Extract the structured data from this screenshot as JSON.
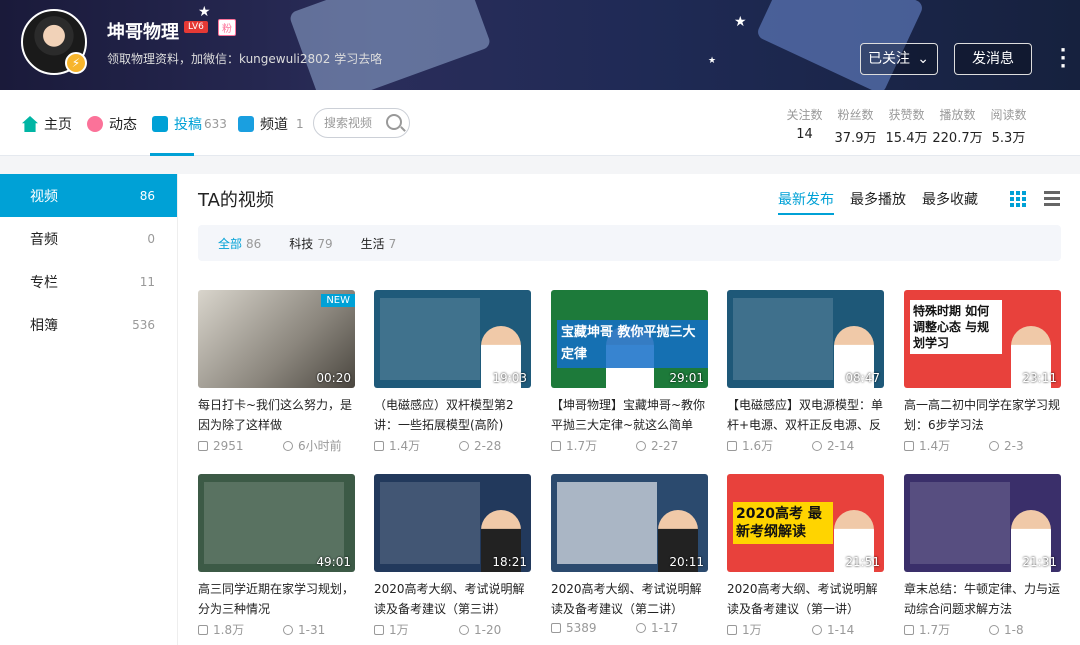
{
  "header": {
    "username": "坤哥物理",
    "level": "LV6",
    "badge": "粉",
    "signature": "领取物理资料，加微信：kungewuli2802 学习去咯",
    "follow_label": "已关注",
    "message_label": "发消息"
  },
  "nav": {
    "home": "主页",
    "dynamic": "动态",
    "uploads": "投稿",
    "uploads_count": "633",
    "channel": "频道",
    "channel_count": "1",
    "search_placeholder": "搜索视频"
  },
  "stats": [
    {
      "label": "关注数",
      "value": "14"
    },
    {
      "label": "粉丝数",
      "value": "37.9万"
    },
    {
      "label": "获赞数",
      "value": "15.4万"
    },
    {
      "label": "播放数",
      "value": "220.7万"
    },
    {
      "label": "阅读数",
      "value": "5.3万"
    }
  ],
  "sidebar": [
    {
      "label": "视频",
      "count": "86"
    },
    {
      "label": "音频",
      "count": "0"
    },
    {
      "label": "专栏",
      "count": "11"
    },
    {
      "label": "相簿",
      "count": "536"
    }
  ],
  "main": {
    "title": "TA的视频",
    "sorts": [
      "最新发布",
      "最多播放",
      "最多收藏"
    ],
    "filters": [
      {
        "label": "全部",
        "count": "86"
      },
      {
        "label": "科技",
        "count": "79"
      },
      {
        "label": "生活",
        "count": "7"
      }
    ]
  },
  "videos": [
    {
      "title": "每日打卡~我们这么努力，是因为除了这样做",
      "duration": "00:20",
      "plays": "2951",
      "date": "6小时前",
      "new": "NEW"
    },
    {
      "title": "（电磁感应）双杆模型第2讲：一些拓展模型(高阶)",
      "duration": "19:03",
      "plays": "1.4万",
      "date": "2-28"
    },
    {
      "title": "【坤哥物理】宝藏坤哥~教你平抛三大定律~就这么简单",
      "duration": "29:01",
      "plays": "1.7万",
      "date": "2-27",
      "overlay": "宝藏坤哥 教你平抛三大定律"
    },
    {
      "title": "【电磁感应】双电源模型：单杆+电源、双杆正反电源、反",
      "duration": "08:47",
      "plays": "1.6万",
      "date": "2-14"
    },
    {
      "title": "高一高二初中同学在家学习规划：6步学习法",
      "duration": "23:11",
      "plays": "1.4万",
      "date": "2-3",
      "overlay": "特殊时期 如何调整心态 与规划学习"
    },
    {
      "title": "高三同学近期在家学习规划，分为三种情况",
      "duration": "49:01",
      "plays": "1.8万",
      "date": "1-31"
    },
    {
      "title": "2020高考大纲、考试说明解读及备考建议（第三讲）",
      "duration": "18:21",
      "plays": "1万",
      "date": "1-20"
    },
    {
      "title": "2020高考大纲、考试说明解读及备考建议（第二讲）",
      "duration": "20:11",
      "plays": "5389",
      "date": "1-17"
    },
    {
      "title": "2020高考大纲、考试说明解读及备考建议（第一讲）",
      "duration": "21:51",
      "plays": "1万",
      "date": "1-14",
      "overlay": "2020高考 最新考纲解读"
    },
    {
      "title": "章末总结：牛顿定律、力与运动综合问题求解方法",
      "duration": "21:31",
      "plays": "1.7万",
      "date": "1-8"
    }
  ]
}
